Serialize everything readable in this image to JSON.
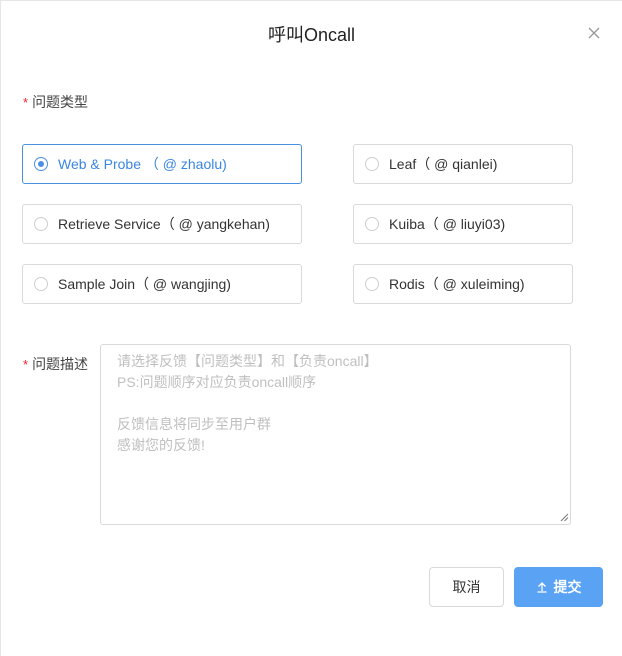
{
  "dialog": {
    "title": "呼叫Oncall"
  },
  "form": {
    "type_label": "问题类型",
    "required_mark": "*",
    "options": [
      {
        "label": "Web & Probe （ @ zhaolu)",
        "selected": true
      },
      {
        "label": "Leaf（ @ qianlei)",
        "selected": false
      },
      {
        "label": "Retrieve Service（ @ yangkehan)",
        "selected": false
      },
      {
        "label": "Kuiba（ @ liuyi03)",
        "selected": false
      },
      {
        "label": "Sample Join（ @ wangjing)",
        "selected": false
      },
      {
        "label": "Rodis（ @ xuleiming)",
        "selected": false
      }
    ],
    "desc_label": "问题描述",
    "desc_value": "",
    "desc_placeholder": "请选择反馈【问题类型】和【负责oncall】\nPS:问题顺序对应负责oncall顺序\n\n反馈信息将同步至用户群\n感谢您的反馈!"
  },
  "footer": {
    "cancel_label": "取消",
    "submit_label": "提交"
  },
  "colors": {
    "accent": "#4a90e2",
    "submit_bg": "#5aa3f4",
    "required": "#f5222d"
  }
}
